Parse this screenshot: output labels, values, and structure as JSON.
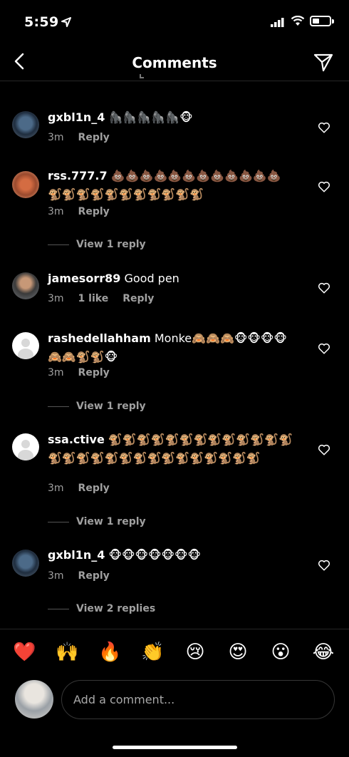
{
  "status": {
    "time": "5:59"
  },
  "header": {
    "title": "Comments",
    "back_icon": "chevron-left-icon",
    "send_icon": "paper-plane-icon"
  },
  "comments": [
    {
      "username": "gxbl1n_4",
      "text": " 🦍🦍🦍🦍🦍🐵",
      "time": "3m",
      "likes": "",
      "reply": "Reply",
      "view_replies": ""
    },
    {
      "username": "rss.777.7",
      "text": " 💩💩💩💩💩💩💩💩💩💩💩💩🐒🐒🐒🐒🐒🐒🐒🐒🐒🐒🐒",
      "time": "3m",
      "likes": "",
      "reply": "Reply",
      "view_replies": "View 1 reply"
    },
    {
      "username": "jamesorr89",
      "text": " Good pen",
      "time": "3m",
      "likes": "1 like",
      "reply": "Reply",
      "view_replies": ""
    },
    {
      "username": "rashedellahham",
      "text": " Monke🙈🙈🙈🐵🐵🐵🐵🙈🙈🐒🐒🐵",
      "time": "3m",
      "likes": "",
      "reply": "Reply",
      "view_replies": "View 1 reply"
    },
    {
      "username": "ssa.ctive",
      "text": " 🐒🐒🐒🐒🐒🐒🐒🐒🐒🐒🐒🐒🐒🐒🐒🐒🐒🐒🐒🐒🐒🐒🐒🐒🐒🐒🐒🐒",
      "time": "3m",
      "likes": "",
      "reply": "Reply",
      "view_replies": "View 1 reply"
    },
    {
      "username": "gxbl1n_4",
      "text": " 🐵🐵🐵🐵🐵🐵🐵",
      "time": "3m",
      "likes": "",
      "reply": "Reply",
      "view_replies": "View 2 replies"
    }
  ],
  "reactions": [
    "❤️",
    "🙌",
    "🔥",
    "👏",
    "😢",
    "😍",
    "😮",
    "😂"
  ],
  "composer": {
    "placeholder": "Add a comment..."
  }
}
